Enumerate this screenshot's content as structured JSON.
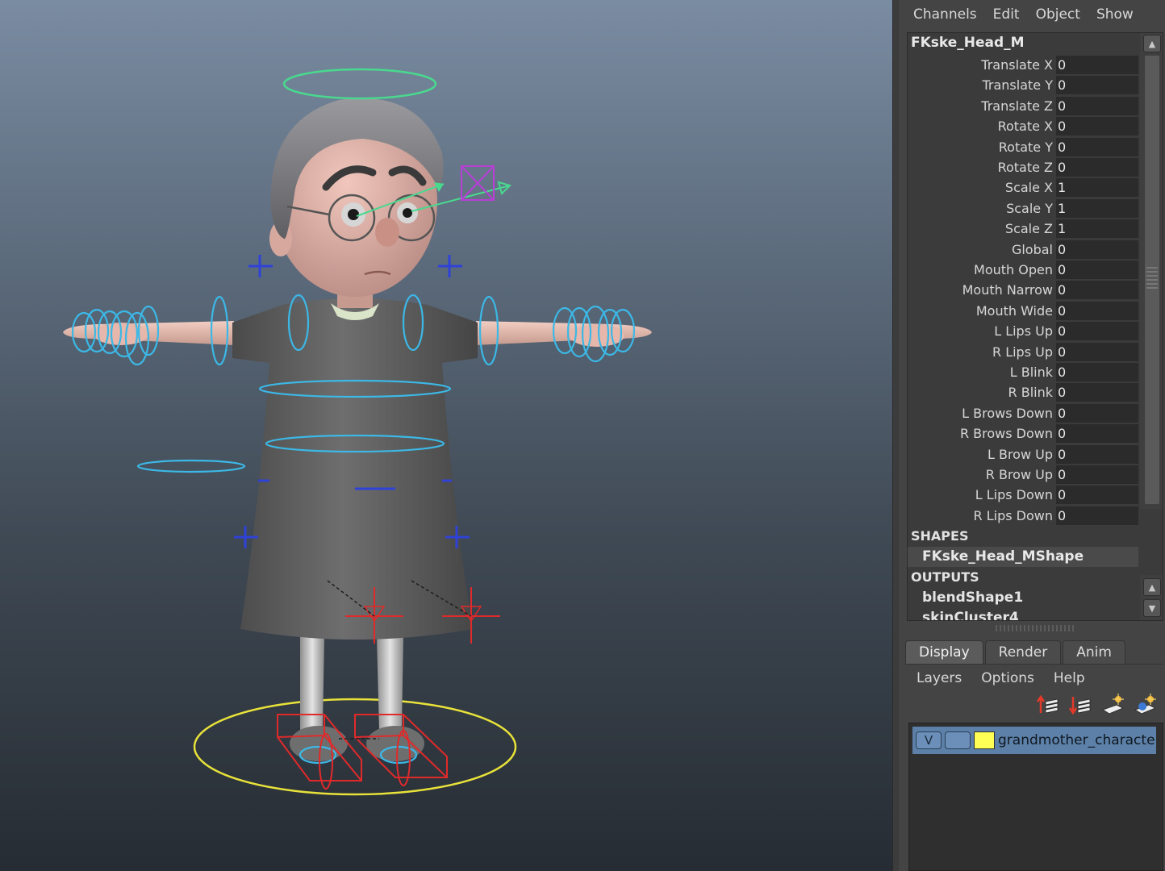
{
  "channels_menu": [
    "Channels",
    "Edit",
    "Object",
    "Show"
  ],
  "channel_box": {
    "object_name": "FKske_Head_M",
    "channels": [
      {
        "label": "Translate X",
        "value": "0"
      },
      {
        "label": "Translate Y",
        "value": "0"
      },
      {
        "label": "Translate Z",
        "value": "0"
      },
      {
        "label": "Rotate X",
        "value": "0"
      },
      {
        "label": "Rotate Y",
        "value": "0"
      },
      {
        "label": "Rotate Z",
        "value": "0"
      },
      {
        "label": "Scale X",
        "value": "1"
      },
      {
        "label": "Scale Y",
        "value": "1"
      },
      {
        "label": "Scale Z",
        "value": "1"
      },
      {
        "label": "Global",
        "value": "0"
      },
      {
        "label": "Mouth Open",
        "value": "0"
      },
      {
        "label": "Mouth Narrow",
        "value": "0"
      },
      {
        "label": "Mouth Wide",
        "value": "0"
      },
      {
        "label": "L Lips Up",
        "value": "0"
      },
      {
        "label": "R Lips Up",
        "value": "0"
      },
      {
        "label": "L Blink",
        "value": "0"
      },
      {
        "label": "R Blink",
        "value": "0"
      },
      {
        "label": "L Brows Down",
        "value": "0"
      },
      {
        "label": "R Brows Down",
        "value": "0"
      },
      {
        "label": "L Brow Up",
        "value": "0"
      },
      {
        "label": "R Brow Up",
        "value": "0"
      },
      {
        "label": "L Lips Down",
        "value": "0"
      },
      {
        "label": "R Lips Down",
        "value": "0"
      }
    ],
    "shapes_label": "SHAPES",
    "shape_name": "FKske_Head_MShape",
    "outputs_label": "OUTPUTS",
    "outputs": [
      "blendShape1",
      "skinCluster4"
    ]
  },
  "layer_editor": {
    "tabs": [
      "Display",
      "Render",
      "Anim"
    ],
    "active_tab": "Display",
    "menu": [
      "Layers",
      "Options",
      "Help"
    ],
    "tool_icons": [
      "move-layer-up-icon",
      "move-layer-down-icon",
      "new-empty-layer-icon",
      "new-layer-from-selection-icon"
    ],
    "layers": [
      {
        "visibility": "V",
        "name": "grandmother_character_l",
        "color": "#ffff55"
      }
    ]
  },
  "viewport": {
    "background_top": "#7a8ca2",
    "background_bottom": "#262c33"
  }
}
